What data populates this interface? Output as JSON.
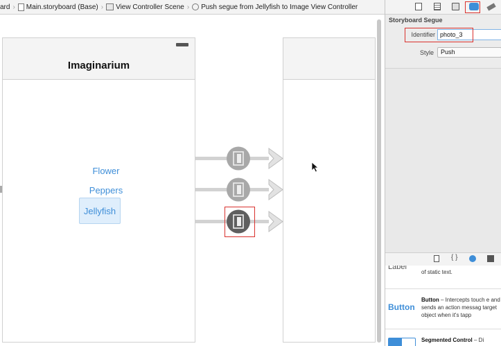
{
  "breadcrumb": {
    "items": [
      "ard",
      "Main.storyboard (Base)",
      "View Controller Scene",
      "Push segue from Jellyfish to Image View Controller"
    ]
  },
  "canvas": {
    "vc1": {
      "title": "Imaginarium",
      "buttons": [
        "Flower",
        "Peppers",
        "Jellyfish"
      ],
      "selected_button": "Jellyfish"
    },
    "segues": {
      "count": 3,
      "selected_index": 2
    }
  },
  "inspector": {
    "tabs": [
      "file-inspector",
      "quick-help",
      "identity-inspector",
      "attributes-inspector",
      "size-inspector"
    ],
    "active_tab": "attributes-inspector",
    "section_title": "Storyboard Segue",
    "identifier_label": "Identifier",
    "identifier_value": "photo_3",
    "style_label": "Style",
    "style_value": "Push"
  },
  "library": {
    "tabs": [
      "file-template",
      "code-snippet",
      "object",
      "media"
    ],
    "items": [
      {
        "icon_text": "Label",
        "text": "of static text."
      },
      {
        "icon_text": "Button",
        "name": "Button",
        "desc": " – Intercepts touch e and sends an action messag target object when it's tapp"
      },
      {
        "icon_text": "",
        "name": "Segmented Control",
        "desc": " – Di"
      }
    ]
  },
  "colors": {
    "accent": "#3e8ed8",
    "highlight": "#d9302c",
    "segue": "#9a9a9a",
    "segue_selected": "#5f5f5f"
  }
}
